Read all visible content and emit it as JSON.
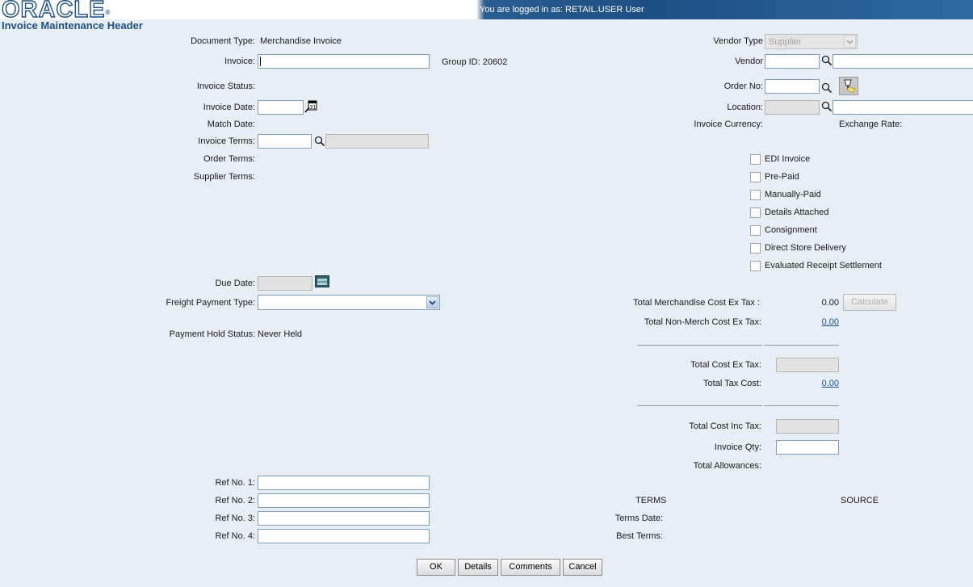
{
  "header": {
    "logo": "ORACLE",
    "logo_mark": "®",
    "login_text": "You are logged in as: RETAIL.USER User",
    "page_title": "Invoice Maintenance Header"
  },
  "left": {
    "document_type_label": "Document Type:",
    "document_type_value": "Merchandise Invoice",
    "invoice_label": "Invoice:",
    "invoice_value": "",
    "group_id": "Group ID: 20602",
    "invoice_status_label": "Invoice Status:",
    "invoice_date_label": "Invoice Date:",
    "match_date_label": "Match Date:",
    "invoice_terms_label": "Invoice Terms:",
    "order_terms_label": "Order Terms:",
    "supplier_terms_label": "Supplier Terms:",
    "due_date_label": "Due Date:",
    "freight_payment_type_label": "Freight Payment Type:",
    "freight_payment_type_value": "",
    "payment_hold_status_label": "Payment Hold Status:",
    "payment_hold_status_value": "Never Held",
    "ref_no_1_label": "Ref No. 1:",
    "ref_no_2_label": "Ref No. 2:",
    "ref_no_3_label": "Ref No. 3:",
    "ref_no_4_label": "Ref No. 4:"
  },
  "right": {
    "vendor_type_label": "Vendor Type",
    "vendor_type_value": "Supplier",
    "vendor_label": "Vendor",
    "order_no_label": "Order No:",
    "location_label": "Location:",
    "invoice_currency_label": "Invoice Currency:",
    "exchange_rate_label": "Exchange Rate:",
    "checkboxes": [
      {
        "label": "EDI Invoice",
        "checked": false
      },
      {
        "label": "Pre-Paid",
        "checked": false
      },
      {
        "label": "Manually-Paid",
        "checked": false
      },
      {
        "label": "Details Attached",
        "checked": false
      },
      {
        "label": "Consignment",
        "checked": false
      },
      {
        "label": "Direct Store Delivery",
        "checked": false
      },
      {
        "label": "Evaluated Receipt Settlement",
        "checked": false
      }
    ],
    "total_merch_cost_label": "Total Merchandise Cost Ex Tax :",
    "total_merch_cost_value": "0.00",
    "calculate_label": "Calculate",
    "total_non_merch_label": "Total Non-Merch Cost Ex Tax:",
    "total_non_merch_value": "0.00",
    "total_cost_ex_tax_label": "Total Cost Ex Tax:",
    "total_tax_cost_label": "Total Tax Cost:",
    "total_tax_cost_value": "0.00",
    "total_cost_inc_tax_label": "Total Cost Inc Tax:",
    "invoice_qty_label": "Invoice Qty:",
    "total_allowances_label": "Total Allowances:",
    "terms_heading": "TERMS",
    "source_heading": "SOURCE",
    "terms_date_label": "Terms Date:",
    "best_terms_label": "Best Terms:"
  },
  "buttons": {
    "ok": "OK",
    "details": "Details",
    "comments": "Comments",
    "cancel": "Cancel"
  }
}
